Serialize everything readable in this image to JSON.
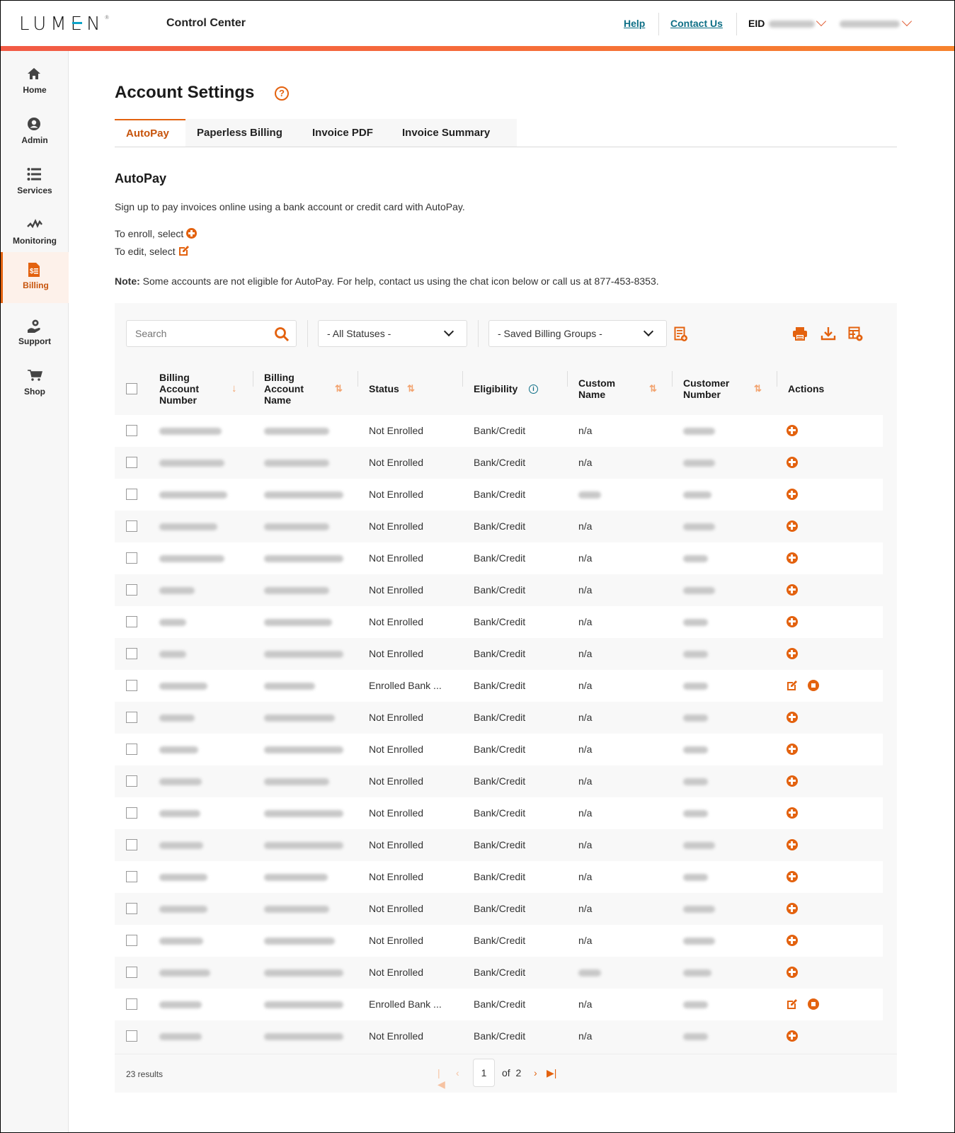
{
  "header": {
    "logo_text": "LUMEN",
    "app_title": "Control Center",
    "links": [
      "Help",
      "Contact Us"
    ],
    "eid_label": "EID"
  },
  "sidebar": {
    "items": [
      {
        "label": "Home",
        "icon": "home-icon",
        "active": false
      },
      {
        "label": "Admin",
        "icon": "user-circle-icon",
        "active": false
      },
      {
        "label": "Services",
        "icon": "list-icon",
        "active": false
      },
      {
        "label": "Monitoring",
        "icon": "pulse-icon",
        "active": false
      },
      {
        "label": "Billing",
        "icon": "invoice-dollar-icon",
        "active": true
      },
      {
        "label": "Support",
        "icon": "support-gear-hand-icon",
        "active": false
      },
      {
        "label": "Shop",
        "icon": "cart-icon",
        "active": false
      }
    ]
  },
  "page": {
    "title": "Account Settings",
    "tabs": [
      {
        "label": "AutoPay",
        "active": true
      },
      {
        "label": "Paperless Billing",
        "active": false
      },
      {
        "label": "Invoice PDF",
        "active": false
      },
      {
        "label": "Invoice Summary",
        "active": false
      }
    ],
    "section_title": "AutoPay",
    "intro": "Sign up to pay invoices online using a bank account or credit card with AutoPay.",
    "enroll_hint": "To enroll, select",
    "edit_hint": "To edit, select",
    "note_label": "Note:",
    "note_text": " Some accounts are not eligible for AutoPay. For help, contact us using the chat icon below or call us at 877-453-8353."
  },
  "filters": {
    "search_placeholder": "Search",
    "status_select": "- All Statuses -",
    "groups_select": "- Saved Billing Groups -"
  },
  "table": {
    "columns": [
      "Billing Account Number",
      "Billing Account Name",
      "Status",
      "Eligibility",
      "Custom Name",
      "Customer Number",
      "Actions"
    ],
    "rows": [
      {
        "status": "Not Enrolled",
        "eligibility": "Bank/Credit",
        "custom_name": "n/a",
        "enrolled": false
      },
      {
        "status": "Not Enrolled",
        "eligibility": "Bank/Credit",
        "custom_name": "n/a",
        "enrolled": false
      },
      {
        "status": "Not Enrolled",
        "eligibility": "Bank/Credit",
        "custom_name": "",
        "enrolled": false
      },
      {
        "status": "Not Enrolled",
        "eligibility": "Bank/Credit",
        "custom_name": "n/a",
        "enrolled": false
      },
      {
        "status": "Not Enrolled",
        "eligibility": "Bank/Credit",
        "custom_name": "n/a",
        "enrolled": false
      },
      {
        "status": "Not Enrolled",
        "eligibility": "Bank/Credit",
        "custom_name": "n/a",
        "enrolled": false
      },
      {
        "status": "Not Enrolled",
        "eligibility": "Bank/Credit",
        "custom_name": "n/a",
        "enrolled": false
      },
      {
        "status": "Not Enrolled",
        "eligibility": "Bank/Credit",
        "custom_name": "n/a",
        "enrolled": false
      },
      {
        "status": "Enrolled Bank ...",
        "eligibility": "Bank/Credit",
        "custom_name": "n/a",
        "enrolled": true
      },
      {
        "status": "Not Enrolled",
        "eligibility": "Bank/Credit",
        "custom_name": "n/a",
        "enrolled": false
      },
      {
        "status": "Not Enrolled",
        "eligibility": "Bank/Credit",
        "custom_name": "n/a",
        "enrolled": false
      },
      {
        "status": "Not Enrolled",
        "eligibility": "Bank/Credit",
        "custom_name": "n/a",
        "enrolled": false
      },
      {
        "status": "Not Enrolled",
        "eligibility": "Bank/Credit",
        "custom_name": "n/a",
        "enrolled": false
      },
      {
        "status": "Not Enrolled",
        "eligibility": "Bank/Credit",
        "custom_name": "n/a",
        "enrolled": false
      },
      {
        "status": "Not Enrolled",
        "eligibility": "Bank/Credit",
        "custom_name": "n/a",
        "enrolled": false
      },
      {
        "status": "Not Enrolled",
        "eligibility": "Bank/Credit",
        "custom_name": "n/a",
        "enrolled": false
      },
      {
        "status": "Not Enrolled",
        "eligibility": "Bank/Credit",
        "custom_name": "n/a",
        "enrolled": false
      },
      {
        "status": "Not Enrolled",
        "eligibility": "Bank/Credit",
        "custom_name": "",
        "enrolled": false
      },
      {
        "status": "Enrolled Bank ...",
        "eligibility": "Bank/Credit",
        "custom_name": "n/a",
        "enrolled": true
      },
      {
        "status": "Not Enrolled",
        "eligibility": "Bank/Credit",
        "custom_name": "n/a",
        "enrolled": false
      }
    ]
  },
  "pagination": {
    "results": "23 results",
    "current_page": "1",
    "of_label": "of",
    "total_pages": "2"
  },
  "colors": {
    "accent": "#e3620f",
    "link": "#0e6f86"
  }
}
